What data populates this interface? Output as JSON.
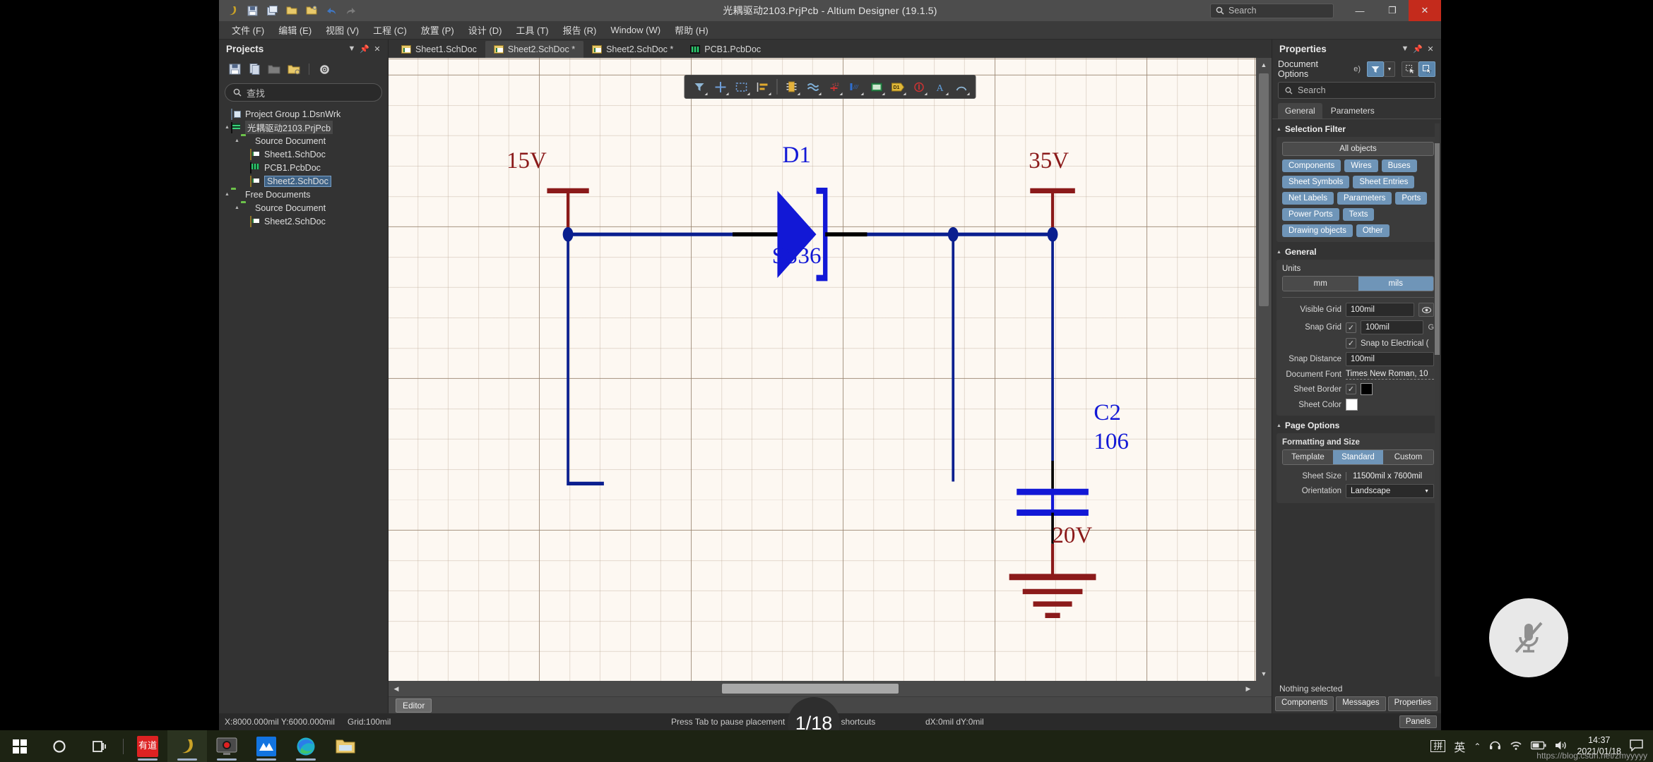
{
  "window": {
    "title": "光耦驱动2103.PrjPcb - Altium Designer (19.1.5)",
    "search_placeholder": "Search",
    "minimize": "—",
    "restore": "❐",
    "close": "✕"
  },
  "quick_access": [
    {
      "name": "altium-logo-icon",
      "glyph": "ꓘ"
    },
    {
      "name": "save-icon",
      "glyph": "▤"
    },
    {
      "name": "save-all-icon",
      "glyph": "▥"
    },
    {
      "name": "open-icon",
      "glyph": "📂"
    },
    {
      "name": "open-project-icon",
      "glyph": "🗂"
    },
    {
      "name": "undo-icon",
      "glyph": "↩"
    },
    {
      "name": "redo-icon",
      "glyph": "↪"
    }
  ],
  "menu": [
    "文件 (F)",
    "编辑 (E)",
    "视图 (V)",
    "工程 (C)",
    "放置 (P)",
    "设计 (D)",
    "工具 (T)",
    "报告 (R)",
    "Window (W)",
    "帮助 (H)"
  ],
  "projects_panel": {
    "title": "Projects",
    "search_placeholder": "查找",
    "toolbar": [
      "save-icon",
      "save-as-icon",
      "open-folder-icon",
      "add-folder-icon",
      "settings-gear-icon"
    ],
    "tree": [
      {
        "label": "Project Group 1.DsnWrk",
        "icon": "project-group-icon",
        "indent": 0,
        "twist": "",
        "state": "normal"
      },
      {
        "label": "光耦驱动2103.PrjPcb",
        "icon": "project-icon",
        "indent": 1,
        "twist": "▴",
        "state": "selsoft"
      },
      {
        "label": "Source Document",
        "icon": "folder-icon",
        "indent": 2,
        "twist": "▴",
        "state": "normal"
      },
      {
        "label": "Sheet1.SchDoc",
        "icon": "schematic-icon",
        "indent": 3,
        "twist": "",
        "state": "normal"
      },
      {
        "label": "PCB1.PcbDoc",
        "icon": "pcb-icon",
        "indent": 3,
        "twist": "",
        "state": "normal"
      },
      {
        "label": "Sheet2.SchDoc",
        "icon": "schematic-icon",
        "indent": 3,
        "twist": "",
        "state": "sel"
      },
      {
        "label": "Free Documents",
        "icon": "folder-icon",
        "indent": 1,
        "twist": "▴",
        "state": "normal"
      },
      {
        "label": "Source Document",
        "icon": "folder-icon",
        "indent": 2,
        "twist": "▴",
        "state": "normal"
      },
      {
        "label": "Sheet2.SchDoc",
        "icon": "schematic-icon",
        "indent": 3,
        "twist": "",
        "state": "normal"
      }
    ]
  },
  "doc_tabs": [
    {
      "label": "Sheet1.SchDoc",
      "icon": "schematic-icon",
      "active": false
    },
    {
      "label": "Sheet2.SchDoc *",
      "icon": "schematic-icon",
      "active": true
    },
    {
      "label": "Sheet2.SchDoc *",
      "icon": "schematic-icon",
      "active": false
    },
    {
      "label": "PCB1.PcbDoc",
      "icon": "pcb-icon",
      "active": false
    }
  ],
  "palette": [
    {
      "name": "filter-icon",
      "glyph": "▼"
    },
    {
      "name": "crosshair-place-icon",
      "glyph": "✛"
    },
    {
      "name": "area-select-icon",
      "glyph": "▭"
    },
    {
      "name": "align-icon",
      "glyph": "▤"
    },
    {
      "name": "place-part-icon",
      "glyph": "▮"
    },
    {
      "name": "place-wire-icon",
      "glyph": "≈"
    },
    {
      "name": "place-power-port-icon",
      "glyph": "⊥"
    },
    {
      "name": "place-net-label-icon",
      "glyph": "▮"
    },
    {
      "name": "place-sheet-symbol-icon",
      "glyph": "▣"
    },
    {
      "name": "place-designator-icon",
      "glyph": "D1"
    },
    {
      "name": "place-no-erc-icon",
      "glyph": "⊙"
    },
    {
      "name": "place-text-icon",
      "glyph": "A"
    },
    {
      "name": "place-arc-icon",
      "glyph": "◠"
    }
  ],
  "schematic": {
    "power_ports": [
      {
        "label": "15V",
        "type": "bar"
      },
      {
        "label": "35V",
        "type": "bar"
      },
      {
        "label": "20V",
        "type": "gnd"
      }
    ],
    "components": [
      {
        "designator": "D1",
        "comment": "SS36",
        "type": "schottky-diode"
      },
      {
        "designator": "C2",
        "comment": "106",
        "type": "capacitor"
      }
    ]
  },
  "editor_status": {
    "tab": "Editor"
  },
  "properties_panel": {
    "title": "Properties",
    "doc_options_label": "Document Options",
    "doc_options_suffix": "e)",
    "search_placeholder": "Search",
    "tabs": [
      {
        "label": "General",
        "active": true
      },
      {
        "label": "Parameters",
        "active": false
      }
    ],
    "selection_filter": {
      "title": "Selection Filter",
      "all_objects": "All objects",
      "chips": [
        "Components",
        "Wires",
        "Buses",
        "Sheet Symbols",
        "Sheet Entries",
        "Net Labels",
        "Parameters",
        "Ports",
        "Power Ports",
        "Texts",
        "Drawing objects",
        "Other"
      ]
    },
    "general": {
      "title": "General",
      "units_label": "Units",
      "units_options": [
        "mm",
        "mils"
      ],
      "units_selected": "mils",
      "visible_grid_label": "Visible Grid",
      "visible_grid_value": "100mil",
      "snap_grid_label": "Snap Grid",
      "snap_grid_value": "100mil",
      "snap_grid_key": "G",
      "snap_electrical_label": "Snap to Electrical (",
      "snap_distance_label": "Snap Distance",
      "snap_distance_value": "100mil",
      "document_font_label": "Document Font",
      "document_font_value": "Times New Roman, 10",
      "sheet_border_label": "Sheet Border",
      "sheet_border_color": "#000000",
      "sheet_color_label": "Sheet Color",
      "sheet_color": "#ffffff"
    },
    "page_options": {
      "title": "Page Options",
      "formatting_label": "Formatting and Size",
      "format_options": [
        "Template",
        "Standard",
        "Custom"
      ],
      "format_selected": "Standard",
      "sheet_size_label": "Sheet Size",
      "sheet_size_value": "11500mil x 7600mil",
      "orientation_label": "Orientation",
      "orientation_value": "Landscape"
    },
    "footer": "Nothing selected",
    "bottom_tabs": [
      "Components",
      "Messages",
      "Properties"
    ]
  },
  "status_bar": {
    "coords": "X:8000.000mil Y:6000.000mil",
    "grid": "Grid:100mil",
    "hint": "Press Tab to pause placement - Press F1 for shortcuts",
    "delta": "dX:0mil dY:0mil",
    "panels": "Panels"
  },
  "overlay": {
    "counter": "1/18",
    "mic_icon": "microphone-muted-icon",
    "watermark": "https://blog.csdn.net/zmyyyyy"
  },
  "taskbar": {
    "items": [
      {
        "name": "start-button",
        "glyph": "⊞"
      },
      {
        "name": "cortana-search-icon",
        "glyph": "◯"
      },
      {
        "name": "task-view-icon",
        "glyph": "❐"
      },
      {
        "name": "youdao-dictionary-icon",
        "glyph": "有道"
      },
      {
        "name": "altium-designer-icon",
        "glyph": "ꓘ"
      },
      {
        "name": "screen-recorder-icon",
        "glyph": "▣"
      },
      {
        "name": "app-blue-icon",
        "glyph": "⩕"
      },
      {
        "name": "microsoft-edge-icon",
        "glyph": "◕"
      },
      {
        "name": "file-explorer-icon",
        "glyph": "🗀"
      }
    ],
    "tray": {
      "ime_mode": "拼",
      "ime_lang": "英",
      "chevron": "⌃",
      "headset": "◠",
      "wifi": "◞",
      "battery": "▭",
      "volume": "◁",
      "time": "14:37",
      "date": "2021/01/18",
      "action_center": "▭"
    }
  }
}
